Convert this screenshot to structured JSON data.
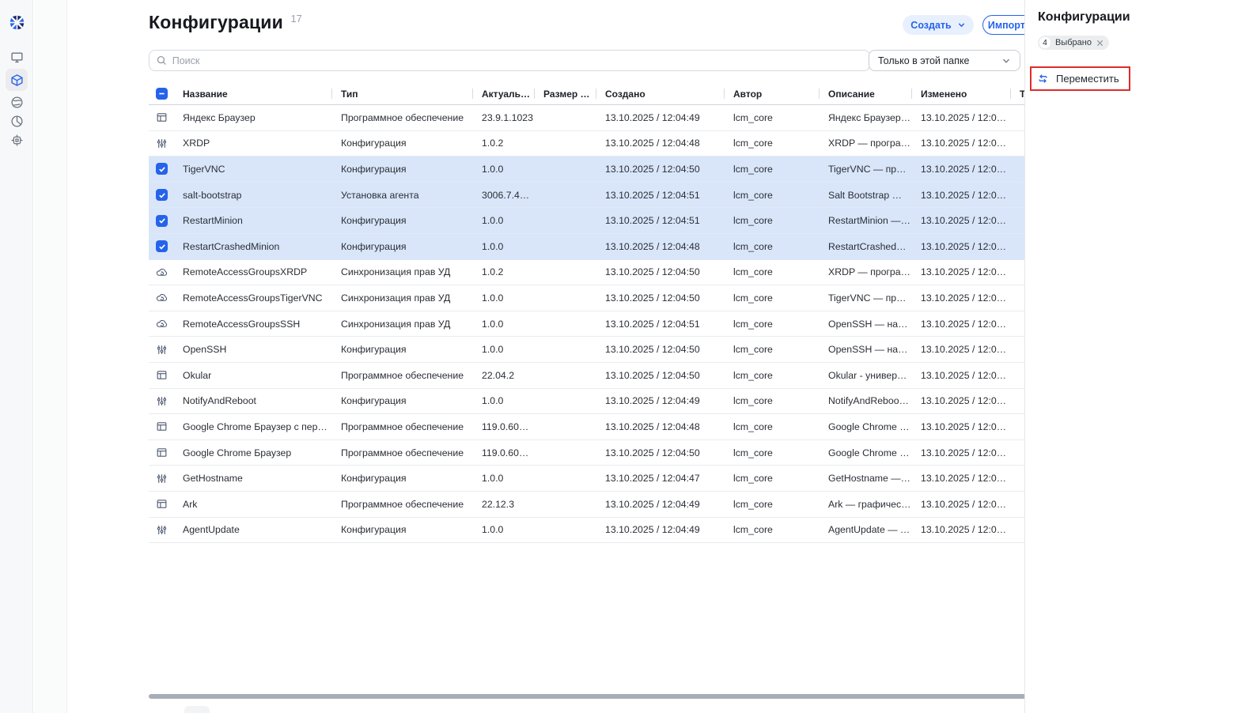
{
  "colors": {
    "accent": "#2563eb",
    "accent_soft_bg": "#e8f0fe",
    "selected_row_bg": "#d9e6fa",
    "annotation_red": "#e02b2b",
    "rail_bg": "#f7f8f9"
  },
  "sidebar": {
    "logo": "company-logo",
    "icons": [
      "monitor-icon",
      "package-icon",
      "globe-icon",
      "pie-chart-icon",
      "chip-icon"
    ],
    "active_icon": "package-icon"
  },
  "vertical_tab": {
    "label": "Конфигурации"
  },
  "header": {
    "title": "Конфигурации",
    "count": "17",
    "create_label": "Создать",
    "import_label": "Импортировать"
  },
  "toolbar": {
    "search_placeholder": "Поиск",
    "scope_value": "Только в этой папке",
    "icons": [
      "filter-funnel-icon",
      "download-icon"
    ]
  },
  "table": {
    "columns": [
      "Название",
      "Тип",
      "Актуаль…",
      "Размер …",
      "Создано",
      "Автор",
      "Описание",
      "Изменено",
      "Теги для…"
    ],
    "rows": [
      {
        "icon": "software",
        "selected": false,
        "name": "Яндекс Браузер",
        "type": "Программное обеспечение",
        "version": "23.9.1.1023",
        "size": "",
        "created": "13.10.2025 / 12:04:49",
        "author": "lcm_core",
        "description": "Яндекс Браузер …",
        "modified": "13.10.2025 / 12:0…",
        "tags": ""
      },
      {
        "icon": "config",
        "selected": false,
        "name": "XRDP",
        "type": "Конфигурация",
        "version": "1.0.2",
        "size": "",
        "created": "13.10.2025 / 12:04:48",
        "author": "lcm_core",
        "description": "XRDP — програ…",
        "modified": "13.10.2025 / 12:0…",
        "tags": ""
      },
      {
        "icon": "checkbox",
        "selected": true,
        "name": "TigerVNC",
        "type": "Конфигурация",
        "version": "1.0.0",
        "size": "",
        "created": "13.10.2025 / 12:04:50",
        "author": "lcm_core",
        "description": "TigerVNC — про…",
        "modified": "13.10.2025 / 12:0…",
        "tags": ""
      },
      {
        "icon": "checkbox",
        "selected": true,
        "name": "salt-bootstrap",
        "type": "Установка агента",
        "version": "3006.7.4…",
        "size": "",
        "created": "13.10.2025 / 12:04:51",
        "author": "lcm_core",
        "description": "Salt Bootstrap — …",
        "modified": "13.10.2025 / 12:0…",
        "tags": ""
      },
      {
        "icon": "checkbox",
        "selected": true,
        "name": "RestartMinion",
        "type": "Конфигурация",
        "version": "1.0.0",
        "size": "",
        "created": "13.10.2025 / 12:04:51",
        "author": "lcm_core",
        "description": "RestartMinion — …",
        "modified": "13.10.2025 / 12:0…",
        "tags": ""
      },
      {
        "icon": "checkbox",
        "selected": true,
        "name": "RestartCrashedMinion",
        "type": "Конфигурация",
        "version": "1.0.0",
        "size": "",
        "created": "13.10.2025 / 12:04:48",
        "author": "lcm_core",
        "description": "RestartCrashedM…",
        "modified": "13.10.2025 / 12:0…",
        "tags": ""
      },
      {
        "icon": "sync",
        "selected": false,
        "name": "RemoteAccessGroupsXRDP",
        "type": "Синхронизация прав УД",
        "version": "1.0.2",
        "size": "",
        "created": "13.10.2025 / 12:04:50",
        "author": "lcm_core",
        "description": "XRDP — програ…",
        "modified": "13.10.2025 / 12:0…",
        "tags": ""
      },
      {
        "icon": "sync",
        "selected": false,
        "name": "RemoteAccessGroupsTigerVNC",
        "type": "Синхронизация прав УД",
        "version": "1.0.0",
        "size": "",
        "created": "13.10.2025 / 12:04:50",
        "author": "lcm_core",
        "description": "TigerVNC — про…",
        "modified": "13.10.2025 / 12:0…",
        "tags": ""
      },
      {
        "icon": "sync",
        "selected": false,
        "name": "RemoteAccessGroupsSSH",
        "type": "Синхронизация прав УД",
        "version": "1.0.0",
        "size": "",
        "created": "13.10.2025 / 12:04:51",
        "author": "lcm_core",
        "description": "OpenSSH — наб…",
        "modified": "13.10.2025 / 12:0…",
        "tags": ""
      },
      {
        "icon": "config",
        "selected": false,
        "name": "OpenSSH",
        "type": "Конфигурация",
        "version": "1.0.0",
        "size": "",
        "created": "13.10.2025 / 12:04:50",
        "author": "lcm_core",
        "description": "OpenSSH — наб…",
        "modified": "13.10.2025 / 12:0…",
        "tags": ""
      },
      {
        "icon": "software",
        "selected": false,
        "name": "Okular",
        "type": "Программное обеспечение",
        "version": "22.04.2",
        "size": "",
        "created": "13.10.2025 / 12:04:50",
        "author": "lcm_core",
        "description": "Okular - универс…",
        "modified": "13.10.2025 / 12:0…",
        "tags": ""
      },
      {
        "icon": "config",
        "selected": false,
        "name": "NotifyAndReboot",
        "type": "Конфигурация",
        "version": "1.0.0",
        "size": "",
        "created": "13.10.2025 / 12:04:49",
        "author": "lcm_core",
        "description": "NotifyAndReboot …",
        "modified": "13.10.2025 / 12:0…",
        "tags": ""
      },
      {
        "icon": "software",
        "selected": false,
        "name": "Google Chrome Браузер с перез…",
        "type": "Программное обеспечение",
        "version": "119.0.60…",
        "size": "",
        "created": "13.10.2025 / 12:04:48",
        "author": "lcm_core",
        "description": "Google Chrome –…",
        "modified": "13.10.2025 / 12:0…",
        "tags": ""
      },
      {
        "icon": "software",
        "selected": false,
        "name": "Google Chrome Браузер",
        "type": "Программное обеспечение",
        "version": "119.0.60…",
        "size": "",
        "created": "13.10.2025 / 12:04:50",
        "author": "lcm_core",
        "description": "Google Chrome –…",
        "modified": "13.10.2025 / 12:0…",
        "tags": ""
      },
      {
        "icon": "config",
        "selected": false,
        "name": "GetHostname",
        "type": "Конфигурация",
        "version": "1.0.0",
        "size": "",
        "created": "13.10.2025 / 12:04:47",
        "author": "lcm_core",
        "description": "GetHostname — …",
        "modified": "13.10.2025 / 12:0…",
        "tags": ""
      },
      {
        "icon": "software",
        "selected": false,
        "name": "Ark",
        "type": "Программное обеспечение",
        "version": "22.12.3",
        "size": "",
        "created": "13.10.2025 / 12:04:49",
        "author": "lcm_core",
        "description": "Ark — графичес…",
        "modified": "13.10.2025 / 12:0…",
        "tags": ""
      },
      {
        "icon": "config",
        "selected": false,
        "name": "AgentUpdate",
        "type": "Конфигурация",
        "version": "1.0.0",
        "size": "",
        "created": "13.10.2025 / 12:04:49",
        "author": "lcm_core",
        "description": "AgentUpdate — …",
        "modified": "13.10.2025 / 12:0…",
        "tags": ""
      }
    ]
  },
  "side_panel": {
    "title": "Конфигурации",
    "selected_count": "4",
    "selected_label": "Выбрано",
    "move_label": "Переместить"
  }
}
